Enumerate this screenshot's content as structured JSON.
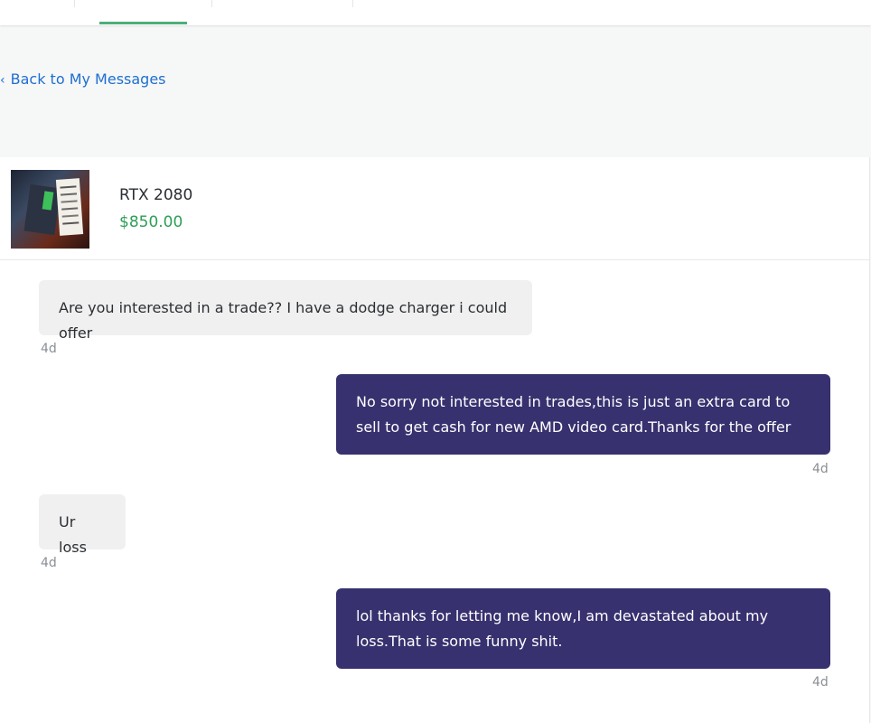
{
  "nav": {
    "back_label": "Back to My Messages",
    "back_chevron": "‹"
  },
  "item": {
    "title": "RTX 2080",
    "price": "$850.00",
    "thumbnail_icon": "product-photo"
  },
  "messages": [
    {
      "direction": "incoming",
      "text": "Are you interested in a trade?? I have a dodge charger i could offer",
      "time": "4d"
    },
    {
      "direction": "outgoing",
      "text": "No sorry not interested in trades,this is just an extra card to sell to get cash for new AMD video card.Thanks for the offer",
      "time": "4d"
    },
    {
      "direction": "incoming",
      "text": "Ur loss",
      "time": "4d"
    },
    {
      "direction": "outgoing",
      "text": "lol thanks for letting me know,I am devastated about my loss.That is some funny shit.",
      "time": "4d"
    }
  ],
  "colors": {
    "accent_green": "#4caf7a",
    "link_blue": "#1f6fd1",
    "price_green": "#2e9e57",
    "outgoing_bubble": "#37316f",
    "incoming_bubble": "#f0f0f0"
  }
}
